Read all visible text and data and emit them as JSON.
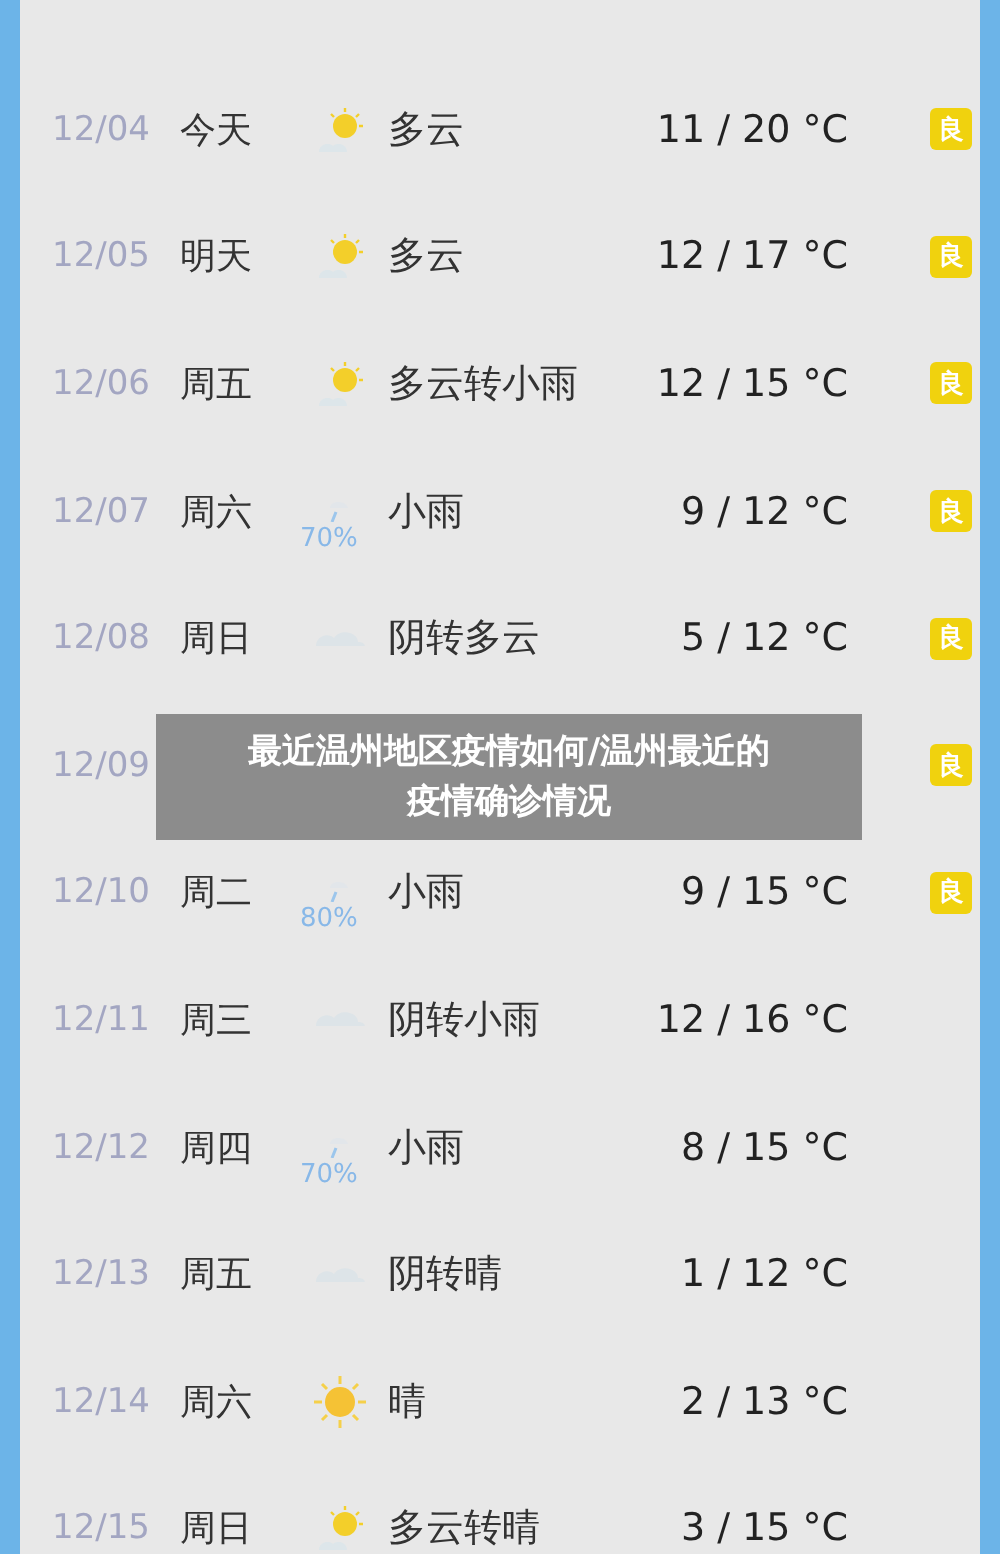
{
  "days": [
    {
      "date": "12/04",
      "weekday": "今天",
      "kind": "partly_cloudy",
      "description": "多云",
      "temperature": "11 / 20 °C",
      "air_quality": "良"
    },
    {
      "date": "12/05",
      "weekday": "明天",
      "kind": "partly_cloudy",
      "description": "多云",
      "temperature": "12 / 17 °C",
      "air_quality": "良"
    },
    {
      "date": "12/06",
      "weekday": "周五",
      "kind": "partly_cloudy",
      "description": "多云转小雨",
      "temperature": "12 / 15 °C",
      "air_quality": "良"
    },
    {
      "date": "12/07",
      "weekday": "周六",
      "kind": "rain",
      "precipitation": "70%",
      "description": "小雨",
      "temperature": "9 / 12 °C",
      "air_quality": "良"
    },
    {
      "date": "12/08",
      "weekday": "周日",
      "kind": "overcast",
      "description": "阴转多云",
      "temperature": "5 / 12 °C",
      "air_quality": "良"
    },
    {
      "date": "12/09",
      "air_quality": "良"
    },
    {
      "date": "12/10",
      "weekday": "周二",
      "kind": "rain",
      "precipitation": "80%",
      "description": "小雨",
      "temperature": "9 / 15 °C",
      "air_quality": "良"
    },
    {
      "date": "12/11",
      "weekday": "周三",
      "kind": "overcast",
      "description": "阴转小雨",
      "temperature": "12 / 16 °C"
    },
    {
      "date": "12/12",
      "weekday": "周四",
      "kind": "rain",
      "precipitation": "70%",
      "description": "小雨",
      "temperature": "8 / 15 °C"
    },
    {
      "date": "12/13",
      "weekday": "周五",
      "kind": "overcast",
      "description": "阴转晴",
      "temperature": "1 / 12 °C"
    },
    {
      "date": "12/14",
      "weekday": "周六",
      "kind": "sunny",
      "description": "晴",
      "temperature": "2 / 13 °C"
    },
    {
      "date": "12/15",
      "weekday": "周日",
      "kind": "partly_cloudy",
      "description": "多云转晴",
      "temperature": "3 / 15 °C"
    }
  ],
  "caption_banner": {
    "text": "最近温州地区疫情如何/温州最近的疫情确诊情况"
  }
}
